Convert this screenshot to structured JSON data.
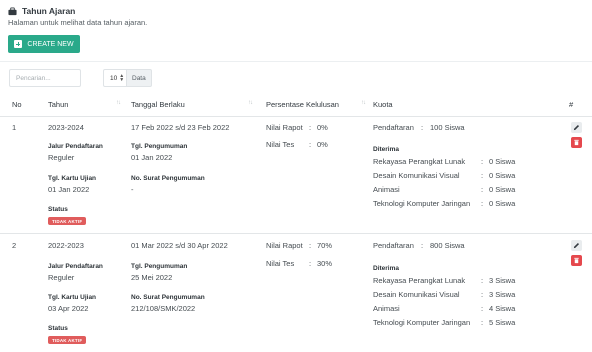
{
  "header": {
    "title": "Tahun Ajaran",
    "subtitle": "Halaman untuk melihat data tahun ajaran."
  },
  "toolbar": {
    "create_label": "CREATE NEW",
    "search_placeholder": "Pencarian...",
    "page_size": "10",
    "page_size_suffix": "Data"
  },
  "table": {
    "columns": [
      "No",
      "Tahun",
      "Tanggal Berlaku",
      "Persentase Kelulusan",
      "Kuota",
      "#"
    ],
    "rows": [
      {
        "no": "1",
        "tahun": "2023-2024",
        "jalur_label": "Jalur Pendaftaran",
        "jalur": "Reguler",
        "kartu_label": "Tgl. Kartu Ujian",
        "kartu": "01 Jan 2022",
        "status_label": "Status",
        "status": "TIDAK AKTIF",
        "tanggal": "17 Feb 2022 s/d 23 Feb 2022",
        "pengumuman_label": "Tgl. Pengumuman",
        "pengumuman": "01 Jan 2022",
        "surat_label": "No. Surat Pengumuman",
        "surat": "-",
        "rapot_label": "Nilai Rapot",
        "rapot_sep": ":",
        "rapot": "0%",
        "tes_label": "Nilai Tes",
        "tes_sep": ":",
        "tes": "0%",
        "pendaftaran_label": "Pendaftaran",
        "pendaftaran_sep": ":",
        "pendaftaran": "100 Siswa",
        "diterima_label": "Diterima",
        "diterima": [
          {
            "name": "Rekayasa Perangkat Lunak",
            "sep": ":",
            "value": "0 Siswa"
          },
          {
            "name": "Desain Komunikasi Visual",
            "sep": ":",
            "value": "0 Siswa"
          },
          {
            "name": "Animasi",
            "sep": ":",
            "value": "0 Siswa"
          },
          {
            "name": "Teknologi Komputer Jaringan",
            "sep": ":",
            "value": "0 Siswa"
          }
        ]
      },
      {
        "no": "2",
        "tahun": "2022-2023",
        "jalur_label": "Jalur Pendaftaran",
        "jalur": "Reguler",
        "kartu_label": "Tgl. Kartu Ujian",
        "kartu": "03 Apr 2022",
        "status_label": "Status",
        "status": "TIDAK AKTIF",
        "tanggal": "01 Mar 2022 s/d 30 Apr 2022",
        "pengumuman_label": "Tgl. Pengumuman",
        "pengumuman": "25 Mei 2022",
        "surat_label": "No. Surat Pengumuman",
        "surat": "212/108/SMK/2022",
        "rapot_label": "Nilai Rapot",
        "rapot_sep": ":",
        "rapot": "70%",
        "tes_label": "Nilai Tes",
        "tes_sep": ":",
        "tes": "30%",
        "pendaftaran_label": "Pendaftaran",
        "pendaftaran_sep": ":",
        "pendaftaran": "800 Siswa",
        "diterima_label": "Diterima",
        "diterima": [
          {
            "name": "Rekayasa Perangkat Lunak",
            "sep": ":",
            "value": "3 Siswa"
          },
          {
            "name": "Desain Komunikasi Visual",
            "sep": ":",
            "value": "3 Siswa"
          },
          {
            "name": "Animasi",
            "sep": ":",
            "value": "4 Siswa"
          },
          {
            "name": "Teknologi Komputer Jaringan",
            "sep": ":",
            "value": "5 Siswa"
          }
        ]
      }
    ]
  },
  "colors": {
    "primary": "#2aa98a",
    "danger": "#e5484d",
    "badge": "#e05c5c"
  },
  "icons": {
    "header": "briefcase-icon",
    "create": "plus-square-icon",
    "edit": "pencil-icon",
    "delete": "trash-icon",
    "sort": "sort-icon"
  }
}
